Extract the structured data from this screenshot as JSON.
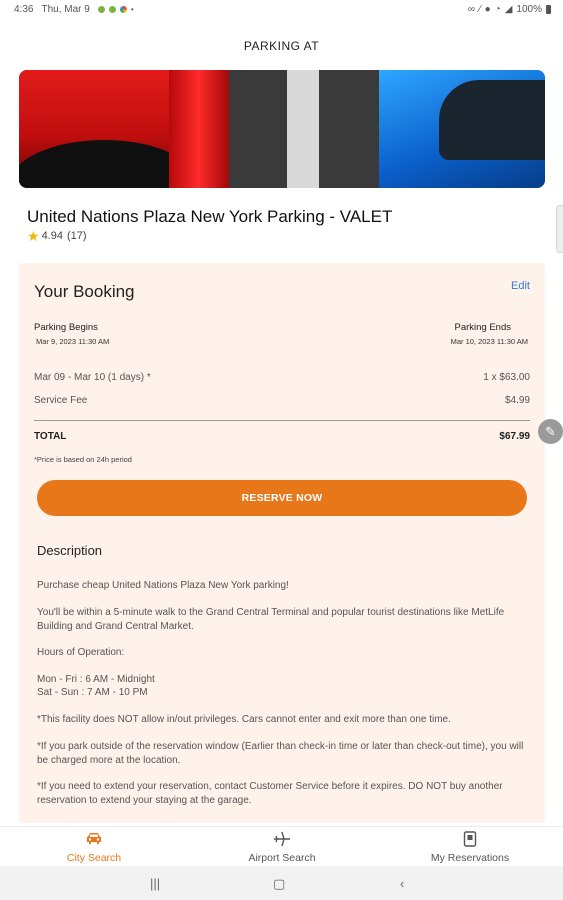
{
  "status_bar": {
    "time": "4:36",
    "date": "Thu, Mar 9",
    "battery": "100%",
    "notification_icons": [
      "android-icon",
      "android-icon",
      "photos-icon"
    ],
    "system_icons": [
      "link-icon",
      "mute-icon",
      "location-icon",
      "wifi-icon",
      "signal-icon",
      "battery-icon"
    ]
  },
  "header": {
    "title": "PARKING AT"
  },
  "facility": {
    "name": "United Nations Plaza New York Parking - VALET",
    "rating": "4.94",
    "reviews": "(17)"
  },
  "booking": {
    "heading": "Your Booking",
    "edit_label": "Edit",
    "begins_label": "Parking Begins",
    "begins_value": "Mar 9, 2023 11:30 AM",
    "ends_label": "Parking Ends",
    "ends_value": "Mar 10, 2023 11:30 AM",
    "line_items": [
      {
        "label": "Mar 09 - Mar 10 (1 days) *",
        "value": "1 x $63.00"
      },
      {
        "label": "Service Fee",
        "value": "$4.99"
      }
    ],
    "total_label": "TOTAL",
    "total_value": "$67.99",
    "note": "*Price is based on 24h period",
    "reserve_label": "RESERVE NOW"
  },
  "description": {
    "heading": "Description",
    "p1": "Purchase cheap United Nations Plaza New York parking!",
    "p2": "You'll be within a 5-minute walk to the Grand Central Terminal and popular tourist destinations like MetLife Building and Grand Central Market.",
    "p3": "Hours of Operation:",
    "p4a": "Mon - Fri : 6 AM - Midnight",
    "p4b": "Sat - Sun : 7 AM - 10 PM",
    "p5": "*This facility does NOT allow in/out privileges. Cars cannot enter and exit more than one time.",
    "p6": "*If you park outside of the reservation window (Earlier than check-in time or later than check-out time), you will be charged more at the location.",
    "p7": "*If you need to extend your reservation, contact Customer Service before it expires. DO NOT buy another reservation to extend your staying at the garage."
  },
  "tabs": [
    {
      "label": "City Search",
      "icon": "car-icon",
      "active": true
    },
    {
      "label": "Airport Search",
      "icon": "airplane-icon",
      "active": false
    },
    {
      "label": "My Reservations",
      "icon": "reservation-icon",
      "active": false
    }
  ],
  "colors": {
    "accent": "#e8771a",
    "card_bg": "#fff2ea",
    "link": "#2f7fd6",
    "star": "#f5b800"
  }
}
